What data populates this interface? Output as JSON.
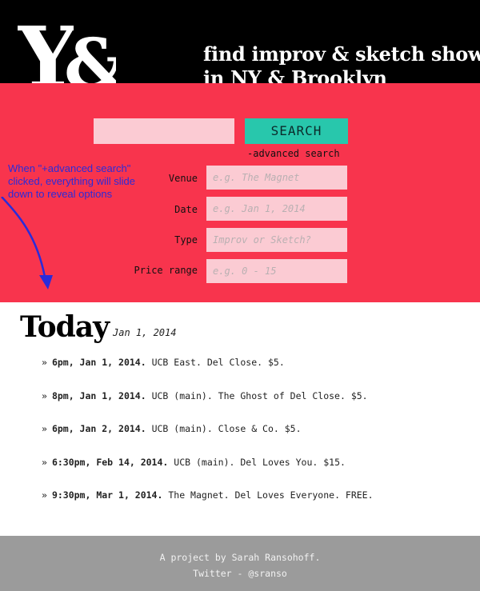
{
  "header": {
    "logo_y": "Y",
    "logo_amp": "&",
    "tagline_line1": "find improv & sketch shows",
    "tagline_line2": "in NY & Brooklyn"
  },
  "search": {
    "input_value": "",
    "button_label": "SEARCH",
    "advanced_link": "-advanced search"
  },
  "advanced": {
    "fields": [
      {
        "label": "Venue",
        "placeholder": "e.g. The Magnet"
      },
      {
        "label": "Date",
        "placeholder": "e.g. Jan 1, 2014"
      },
      {
        "label": "Type",
        "placeholder": "Improv or Sketch?"
      },
      {
        "label": "Price range",
        "placeholder": "e.g. 0 - 15"
      }
    ]
  },
  "annotation": {
    "text": "When \"+advanced search\" clicked, everything will slide down to reveal options"
  },
  "today": {
    "title": "Today",
    "date": "Jan 1, 2014"
  },
  "shows": [
    {
      "bullet": "»",
      "time": "6pm, Jan 1, 2014.",
      "details": "UCB East. Del Close. $5."
    },
    {
      "bullet": "»",
      "time": "8pm, Jan 1, 2014.",
      "details": "UCB (main). The Ghost of Del Close. $5."
    },
    {
      "bullet": "»",
      "time": "6pm, Jan 2, 2014.",
      "details": "UCB (main). Close & Co. $5."
    },
    {
      "bullet": "»",
      "time": "6:30pm, Feb 14, 2014.",
      "details": "UCB (main). Del Loves You. $15."
    },
    {
      "bullet": "»",
      "time": "9:30pm, Mar 1, 2014.",
      "details": "The Magnet. Del Loves Everyone. FREE."
    }
  ],
  "footer": {
    "line1": "A project by Sarah Ransohoff.",
    "line2": "Twitter - @sranso"
  },
  "colors": {
    "header_bg": "#000000",
    "accent_red": "#f8344d",
    "accent_teal": "#28c7ac",
    "input_pink": "#fbcbd3",
    "annotation_blue": "#2b2bd9",
    "footer_gray": "#9b9b9b"
  }
}
